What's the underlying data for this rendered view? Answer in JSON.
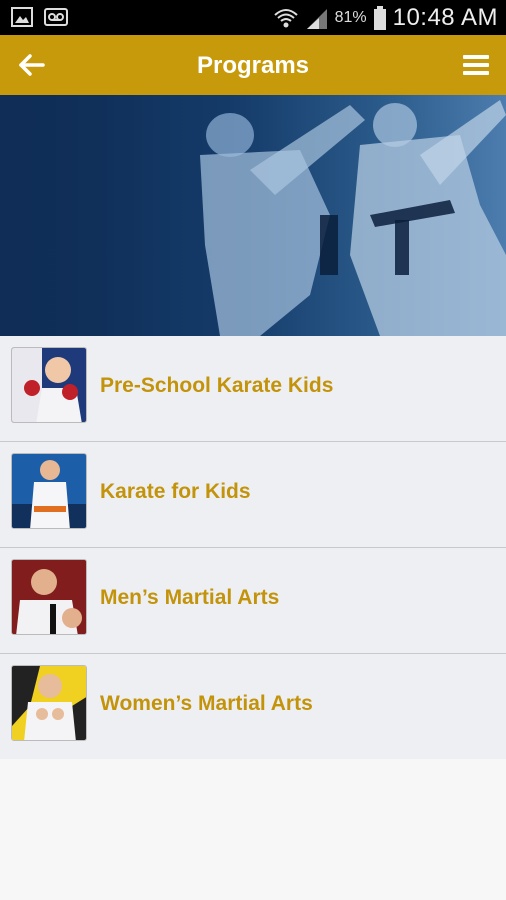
{
  "status_bar": {
    "battery": "81%",
    "time": "10:48 AM",
    "icons": [
      "image-icon",
      "voicemail-icon",
      "wifi-icon",
      "signal-icon",
      "battery-icon"
    ]
  },
  "app_bar": {
    "title": "Programs",
    "background": "#c79a0b",
    "back_icon": "arrow-left-icon",
    "menu_icon": "hamburger-menu-icon"
  },
  "hero": {
    "description_color": "#143a68"
  },
  "programs": [
    {
      "label": "Pre-School Karate Kids"
    },
    {
      "label": "Karate for Kids"
    },
    {
      "label": "Men’s Martial Arts"
    },
    {
      "label": "Women’s Martial Arts"
    }
  ],
  "colors": {
    "accent": "#c79a0b",
    "label": "#c3940b",
    "list_background": "#eeeff3"
  }
}
